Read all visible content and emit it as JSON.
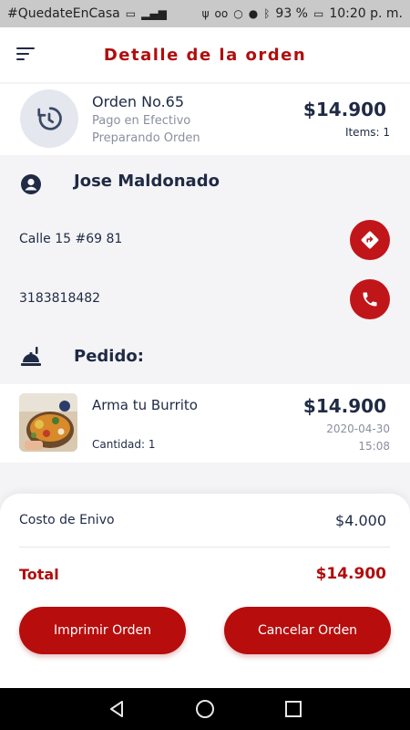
{
  "status_bar": {
    "carrier": "#QuedateEnCasa",
    "battery": "93 %",
    "time": "10:20 p. m."
  },
  "header": {
    "title": "Detalle de la orden"
  },
  "order": {
    "number": "Orden No.65",
    "payment": "Pago en Efectivo",
    "status": "Preparando Orden",
    "price": "$14.900",
    "items": "Items: 1"
  },
  "customer": {
    "name": "Jose Maldonado",
    "address": "Calle 15 #69 81",
    "phone": "3183818482"
  },
  "pedido": {
    "title": "Pedido:"
  },
  "product": {
    "name": "Arma tu Burrito",
    "quantity": "Cantidad: 1",
    "price": "$14.900",
    "date": "2020-04-30",
    "time": "15:08"
  },
  "summary": {
    "shipping_label": "Costo de Enivo",
    "shipping_value": "$4.000",
    "total_label": "Total",
    "total_value": "$14.900"
  },
  "actions": {
    "print_label": "Imprimir Orden",
    "cancel_label": "Cancelar Orden"
  },
  "colors": {
    "brand_red": "#b00d0d",
    "dark_text": "#1f2a44",
    "muted_text": "#8a8f9c"
  },
  "icons": {
    "menu": "menu-icon",
    "order_status": "refresh-clock-icon",
    "customer": "person-icon",
    "directions": "directions-icon",
    "call": "phone-icon",
    "pedido": "food-tray-icon",
    "nav_back": "back-triangle-icon",
    "nav_home": "home-circle-icon",
    "nav_recents": "recents-square-icon"
  }
}
